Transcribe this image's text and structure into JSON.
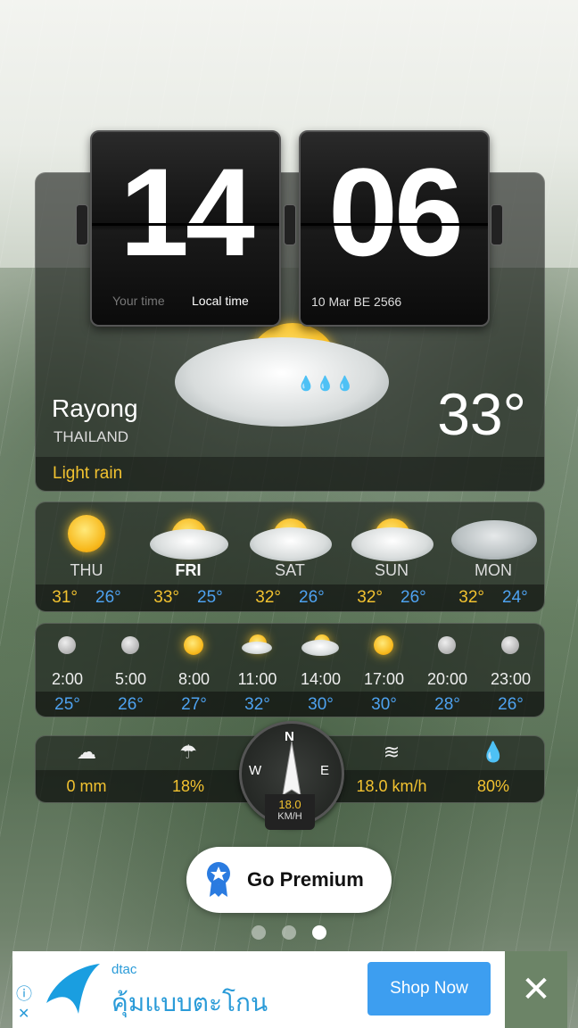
{
  "clock": {
    "hour": "14",
    "minute": "06",
    "your_time_label": "Your time",
    "local_time_label": "Local time",
    "date": "10 Mar BE 2566"
  },
  "current": {
    "city": "Rayong",
    "country": "THAILAND",
    "temperature": "33°",
    "condition": "Light rain",
    "icon": "sun-cloud-rain-icon"
  },
  "forecast": [
    {
      "day": "THU",
      "high": "31°",
      "low": "26°",
      "icon": "sun-icon"
    },
    {
      "day": "FRI",
      "high": "33°",
      "low": "25°",
      "icon": "sun-cloud-rain-icon"
    },
    {
      "day": "SAT",
      "high": "32°",
      "low": "26°",
      "icon": "sun-cloud-rain-icon"
    },
    {
      "day": "SUN",
      "high": "32°",
      "low": "26°",
      "icon": "sun-cloud-rain-icon"
    },
    {
      "day": "MON",
      "high": "32°",
      "low": "24°",
      "icon": "thunderstorm-icon"
    }
  ],
  "hourly": [
    {
      "time": "2:00",
      "temp": "25°",
      "icon": "moon-icon"
    },
    {
      "time": "5:00",
      "temp": "26°",
      "icon": "moon-icon"
    },
    {
      "time": "8:00",
      "temp": "27°",
      "icon": "sun-icon"
    },
    {
      "time": "11:00",
      "temp": "32°",
      "icon": "sun-cloud-icon"
    },
    {
      "time": "14:00",
      "temp": "30°",
      "icon": "cloud-rain-icon"
    },
    {
      "time": "17:00",
      "temp": "30°",
      "icon": "sun-icon"
    },
    {
      "time": "20:00",
      "temp": "28°",
      "icon": "moon-icon"
    },
    {
      "time": "23:00",
      "temp": "26°",
      "icon": "moon-icon"
    }
  ],
  "details": {
    "precip": "0 mm",
    "chance": "18%",
    "wind": "18.0 km/h",
    "humidity": "80%"
  },
  "compass": {
    "n": "N",
    "e": "E",
    "w": "W",
    "speed": "18.0",
    "unit": "KM/H"
  },
  "premium": {
    "label": "Go Premium"
  },
  "ad": {
    "brand": "dtac",
    "slogan": "คุ้มแบบตะโกน",
    "button": "Shop Now",
    "close": "✕",
    "info": "ⓘ",
    "x": "✕"
  },
  "colors": {
    "accent": "#f2c230",
    "low_temp": "#4ea2f0",
    "ad_button": "#3d9ef0"
  }
}
